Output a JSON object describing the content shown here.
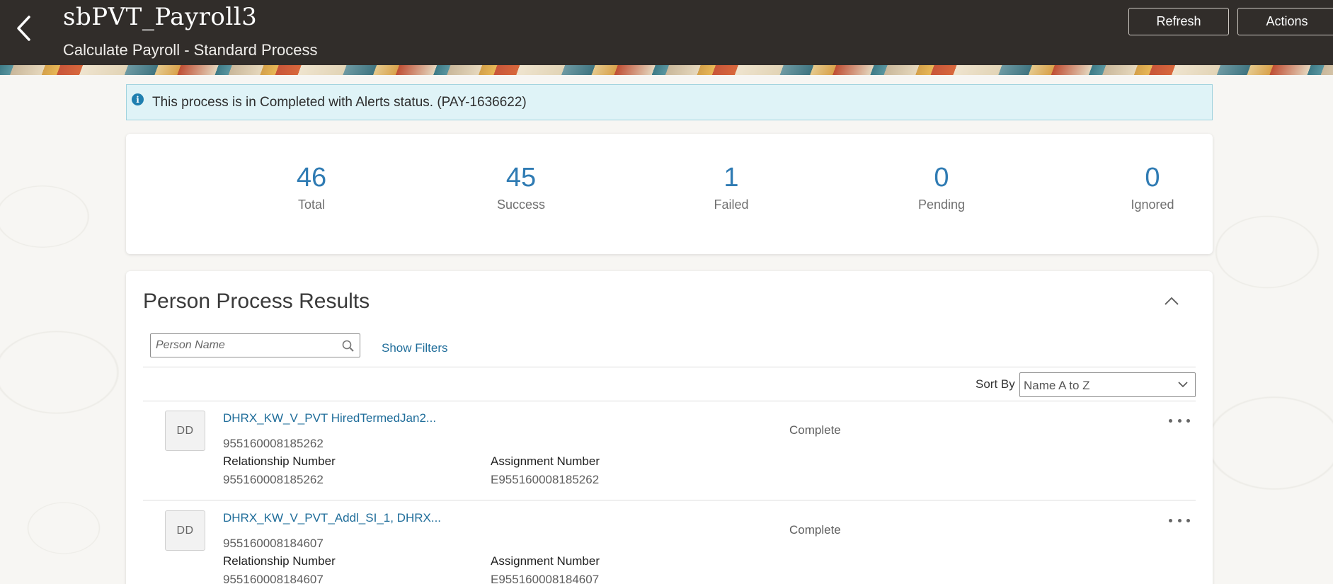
{
  "header": {
    "title": "sbPVT_Payroll3",
    "subtitle": "Calculate Payroll - Standard Process",
    "refresh_label": "Refresh",
    "actions_label": "Actions",
    "back_icon": "chevron-left-icon"
  },
  "banner": {
    "icon": "info-icon",
    "message": "This process is in Completed with Alerts status. (PAY-1636622)"
  },
  "stats": [
    {
      "value": "46",
      "label": "Total"
    },
    {
      "value": "45",
      "label": "Success"
    },
    {
      "value": "1",
      "label": "Failed"
    },
    {
      "value": "0",
      "label": "Pending"
    },
    {
      "value": "0",
      "label": "Ignored"
    }
  ],
  "results": {
    "title": "Person Process Results",
    "search_placeholder": "Person Name",
    "show_filters_label": "Show Filters",
    "sort_by_label": "Sort By",
    "sort_value": "Name A to Z",
    "rows": [
      {
        "initials": "DD",
        "name": "DHRX_KW_V_PVT HiredTermedJan2...",
        "person_number": "955160008185262",
        "relationship_label": "Relationship Number",
        "relationship_value": "955160008185262",
        "assignment_label": "Assignment Number",
        "assignment_value": "E955160008185262",
        "status": "Complete"
      },
      {
        "initials": "DD",
        "name": "DHRX_KW_V_PVT_Addl_SI_1, DHRX...",
        "person_number": "955160008184607",
        "relationship_label": "Relationship Number",
        "relationship_value": "955160008184607",
        "assignment_label": "Assignment Number",
        "assignment_value": "E955160008184607",
        "status": "Complete"
      }
    ]
  },
  "colors": {
    "header_bg": "#312d2a",
    "accent_blue": "#2f7bb3",
    "link_blue": "#1f6d9a",
    "banner_bg": "#dff3f7"
  }
}
